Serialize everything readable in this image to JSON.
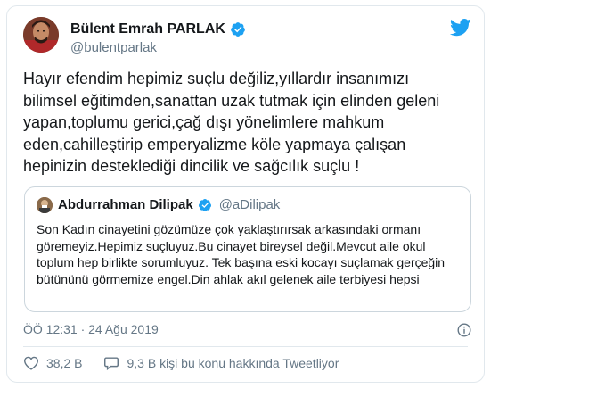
{
  "author": {
    "display_name": "Bülent Emrah PARLAK",
    "handle": "@bulentparlak",
    "verified": true
  },
  "tweet": {
    "text": "Hayır efendim hepimiz suçlu değiliz,yıllardır insanımızı\nbilimsel eğitimden,sanattan uzak tutmak için elinden geleni\nyapan,toplumu gerici,çağ dışı yönelimlere mahkum\neden,cahilleştirip emperyalizme köle yapmaya çalışan\nhepinizin desteklediği dincilik ve sağcılık suçlu !"
  },
  "quoted_tweet": {
    "display_name": "Abdurrahman Dilipak",
    "handle": "@aDilipak",
    "verified": true,
    "text": "Son Kadın cinayetini gözümüze çok yaklaştırırsak arkasındaki ormanı göremeyiz.Hepimiz suçluyuz.Bu cinayet bireysel değil.Mevcut aile okul toplum hep birlikte sorumluyuz. Tek başına eski kocayı suçlamak gerçeğin bütününü görmemize engel.Din ahlak akıl gelenek aile terbiyesi hepsi"
  },
  "timestamp": "ÖÖ 12:31 · 24 Ağu 2019",
  "actions": {
    "likes": "38,2 B",
    "talking_about": "9,3 B kişi bu konu hakkında Tweetliyor"
  },
  "icons": {
    "platform": "twitter-bird-icon",
    "verified": "verified-badge-icon",
    "info": "info-icon",
    "like": "heart-icon",
    "reply": "speech-bubble-icon"
  },
  "colors": {
    "brand_blue": "#1da1f2",
    "text_primary": "#14171a",
    "text_secondary": "#657786",
    "border": "#e1e8ed"
  }
}
